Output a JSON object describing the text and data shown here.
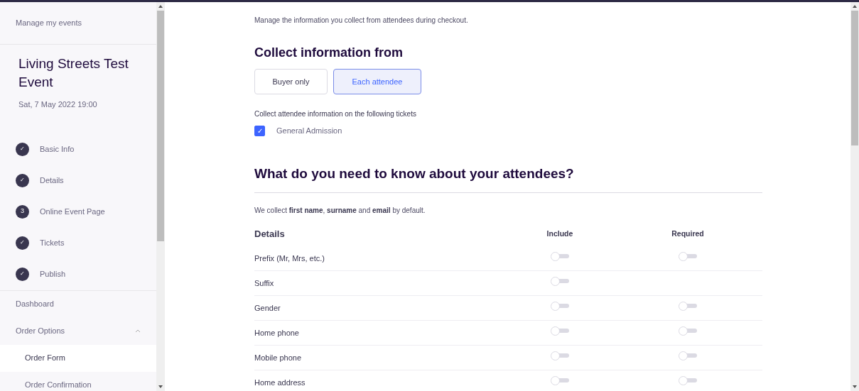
{
  "sidebar": {
    "back_link": "Manage my events",
    "event_title": "Living Streets Test Event",
    "event_date": "Sat, 7 May 2022 19:00",
    "steps": [
      {
        "label": "Basic Info",
        "kind": "done",
        "marker": "✓"
      },
      {
        "label": "Details",
        "kind": "done",
        "marker": "✓"
      },
      {
        "label": "Online Event Page",
        "kind": "number",
        "marker": "3"
      },
      {
        "label": "Tickets",
        "kind": "done",
        "marker": "✓"
      },
      {
        "label": "Publish",
        "kind": "done",
        "marker": "✓"
      }
    ],
    "menu": [
      {
        "label": "Dashboard",
        "kind": "item",
        "selected": false
      },
      {
        "label": "Order Options",
        "kind": "group",
        "expanded": true,
        "selected": false
      },
      {
        "label": "Order Form",
        "kind": "subitem",
        "selected": true
      },
      {
        "label": "Order Confirmation",
        "kind": "subitem",
        "selected": false
      }
    ]
  },
  "main": {
    "intro": "Manage the information you collect from attendees during checkout.",
    "collect_heading": "Collect information from",
    "collect_options": [
      {
        "label": "Buyer only",
        "selected": false
      },
      {
        "label": "Each attendee",
        "selected": true
      }
    ],
    "tickets_label": "Collect attendee information on the following tickets",
    "tickets": [
      {
        "label": "General Admission",
        "checked": true
      }
    ],
    "attendees_heading": "What do you need to know about your attendees?",
    "default_note": "We collect **first name**, **surname** and **email** by default.",
    "table": {
      "columns": [
        "Details",
        "Include",
        "Required"
      ],
      "rows": [
        {
          "label": "Prefix (Mr, Mrs, etc.)",
          "include": false,
          "required": false
        },
        {
          "label": "Suffix",
          "include": false
        },
        {
          "label": "Gender",
          "include": false,
          "required": false
        },
        {
          "label": "Home phone",
          "include": false,
          "required": false
        },
        {
          "label": "Mobile phone",
          "include": false,
          "required": false
        },
        {
          "label": "Home address",
          "include": false,
          "required": false
        }
      ]
    }
  }
}
